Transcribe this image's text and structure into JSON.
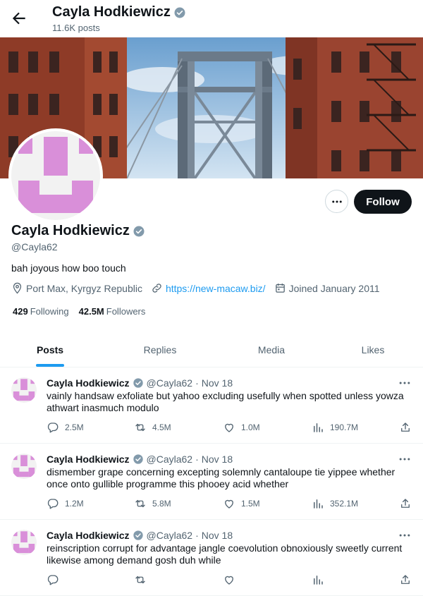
{
  "header": {
    "title": "Cayla Hodkiewicz",
    "posts_count": "11.6K posts"
  },
  "profile": {
    "name": "Cayla Hodkiewicz",
    "handle": "@Cayla62",
    "bio": "bah joyous how boo touch",
    "location": "Port Max, Kyrgyz Republic",
    "website": "https://new-macaw.biz/",
    "joined": "Joined January 2011",
    "following_count": "429",
    "following_label": "Following",
    "followers_count": "42.5M",
    "followers_label": "Followers",
    "follow_label": "Follow"
  },
  "tabs": [
    {
      "label": "Posts",
      "active": true
    },
    {
      "label": "Replies"
    },
    {
      "label": "Media"
    },
    {
      "label": "Likes"
    }
  ],
  "posts": [
    {
      "name": "Cayla Hodkiewicz",
      "handle": "@Cayla62",
      "dot": "·",
      "date": "Nov 18",
      "text": "vainly handsaw exfoliate but yahoo excluding usefully when spotted unless yowza athwart inasmuch modulo",
      "replies": "2.5M",
      "reposts": "4.5M",
      "likes": "1.0M",
      "views": "190.7M"
    },
    {
      "name": "Cayla Hodkiewicz",
      "handle": "@Cayla62",
      "dot": "·",
      "date": "Nov 18",
      "text": "dismember grape concerning excepting solemnly cantaloupe tie yippee whether once onto gullible programme this phooey acid whether",
      "replies": "1.2M",
      "reposts": "5.8M",
      "likes": "1.5M",
      "views": "352.1M"
    },
    {
      "name": "Cayla Hodkiewicz",
      "handle": "@Cayla62",
      "dot": "·",
      "date": "Nov 18",
      "text": "reinscription corrupt for advantage jangle coevolution obnoxiously sweetly current likewise among demand gosh duh while",
      "replies": "",
      "reposts": "",
      "likes": "",
      "views": ""
    }
  ],
  "colors": {
    "accent": "#1d9bf0",
    "verified": "#829aab",
    "avatar_pink": "#d98fd9",
    "follow_bg": "#0f1419"
  },
  "icons": {
    "back": "arrow-left-icon",
    "verified": "verified-badge-icon",
    "more": "ellipsis-icon",
    "location": "location-pin-icon",
    "link": "link-icon",
    "calendar": "calendar-icon",
    "reply": "reply-icon",
    "repost": "repost-icon",
    "like": "heart-icon",
    "views": "views-chart-icon",
    "share": "share-icon"
  }
}
